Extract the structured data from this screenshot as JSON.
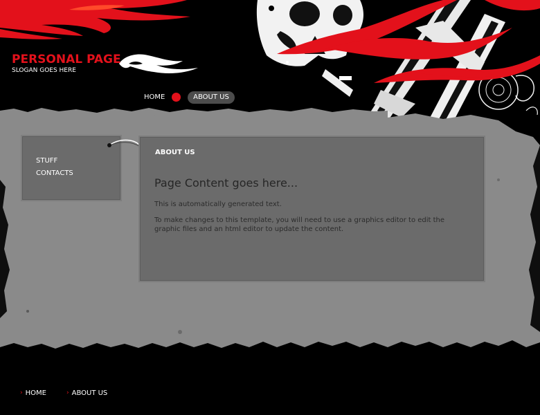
{
  "header": {
    "title": "PERSONAL PAGE",
    "slogan": "SLOGAN GOES HERE",
    "nav": {
      "home_label": "HOME",
      "about_label": "ABOUT US"
    },
    "logo_icon": "tribal-flame-icon"
  },
  "sidebar": {
    "items": [
      {
        "label": "STUFF"
      },
      {
        "label": "CONTACTS"
      }
    ]
  },
  "content": {
    "heading": "ABOUT US",
    "title": "Page Content goes here...",
    "paragraphs": [
      "This is automatically generated text.",
      "To make changes to this template, you will need to use a graphics editor to edit the graphic files and an html editor to update the content."
    ]
  },
  "footer": {
    "links": [
      {
        "label": "HOME"
      },
      {
        "label": "ABOUT US"
      }
    ],
    "arrow_icon": "chevron-right-icon"
  },
  "colors": {
    "accent": "#e3111b",
    "panel": "#6b6b6b",
    "background": "#000000",
    "grunge": "#8a8a8a"
  }
}
